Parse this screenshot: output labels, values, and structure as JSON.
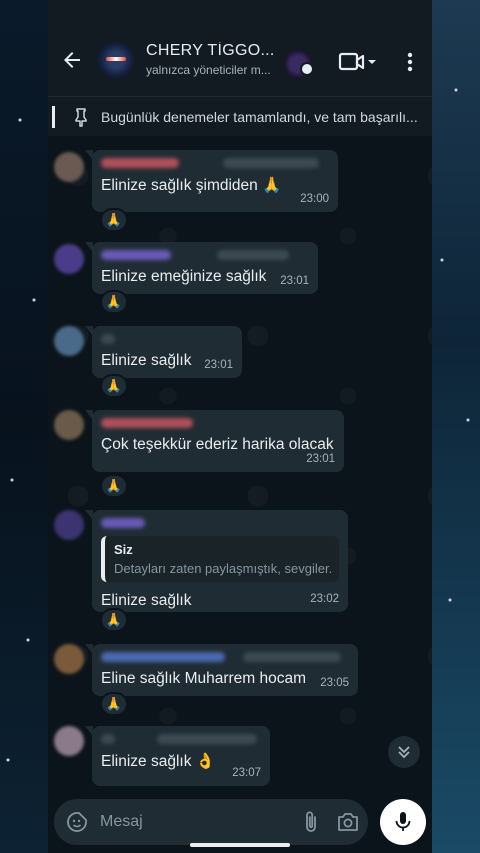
{
  "header": {
    "title": "CHERY TİGGO...",
    "subtitle": "yalnızca yöneticiler m..."
  },
  "pinned": {
    "text": "Bugünlük denemeler tamamlandı, ve tam başarılı..."
  },
  "messages": [
    {
      "text": "Elinize sağlık şimdiden 🙏",
      "time": "23:00",
      "reaction": "🙏",
      "avatar_color": "#6b5a52"
    },
    {
      "text": "Elinize emeğinize sağlık",
      "time": "23:01",
      "reaction": "🙏",
      "avatar_color": "#4b3c8a"
    },
    {
      "text": "Elinize sağlık",
      "time": "23:01",
      "reaction": "🙏",
      "avatar_color": "#4a6a8a"
    },
    {
      "text": "Çok teşekkür ederiz harika olacak",
      "time": "23:01",
      "reaction": "🙏",
      "avatar_color": "#6a5a4a"
    },
    {
      "text": "Elinize sağlık",
      "time": "23:02",
      "reaction": "🙏",
      "avatar_color": "#3c3470",
      "quote": {
        "name": "Siz",
        "text": "Detayları zaten paylaşmıştık, sevgiler."
      }
    },
    {
      "text": "Eline sağlık Muharrem hocam",
      "time": "23:05",
      "reaction": "🙏",
      "avatar_color": "#7a5a3a"
    },
    {
      "text": "Elinize sağlık 👌",
      "time": "23:07",
      "reaction": "",
      "avatar_color": "#8a7a8a"
    }
  ],
  "composer": {
    "placeholder": "Mesaj"
  },
  "icons": {
    "back": "arrow-left-icon",
    "video": "video-call-icon",
    "menu": "more-vert-icon",
    "pin": "pin-icon",
    "emoji": "emoji-sticker-icon",
    "attach": "paperclip-icon",
    "camera": "camera-icon",
    "mic": "mic-icon",
    "scroll": "double-chevron-down-icon"
  }
}
